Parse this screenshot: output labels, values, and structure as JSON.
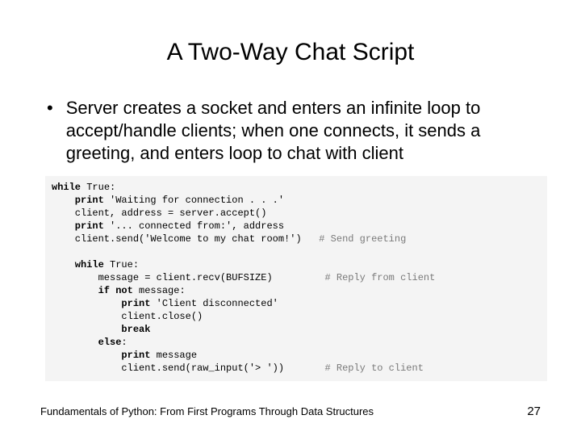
{
  "title": "A Two-Way Chat Script",
  "bullet": "Server creates a socket and enters an infinite loop to accept/handle clients; when one connects, it sends a greeting, and enters loop to chat with client",
  "code": {
    "l01a": "while",
    "l01b": " True:",
    "l02a": "    print",
    "l02b": " 'Waiting for connection . . .'",
    "l03": "    client, address = server.accept()",
    "l04a": "    print",
    "l04b": " '... connected from:', address",
    "l05a": "    client.send('Welcome to my chat room!')   ",
    "l05c": "# Send greeting",
    "blank1": "",
    "l06a": "    while",
    "l06b": " True:",
    "l07a": "        message = client.recv(BUFSIZE)         ",
    "l07c": "# Reply from client",
    "l08a": "        if not",
    "l08b": " message:",
    "l09a": "            print",
    "l09b": " 'Client disconnected'",
    "l10": "            client.close()",
    "l11a": "            break",
    "l12a": "        else",
    "l12b": ":",
    "l13a": "            print",
    "l13b": " message",
    "l14a": "            client.send(raw_input('> '))       ",
    "l14c": "# Reply to client"
  },
  "footer": "Fundamentals of Python: From First Programs Through Data Structures",
  "page": "27"
}
